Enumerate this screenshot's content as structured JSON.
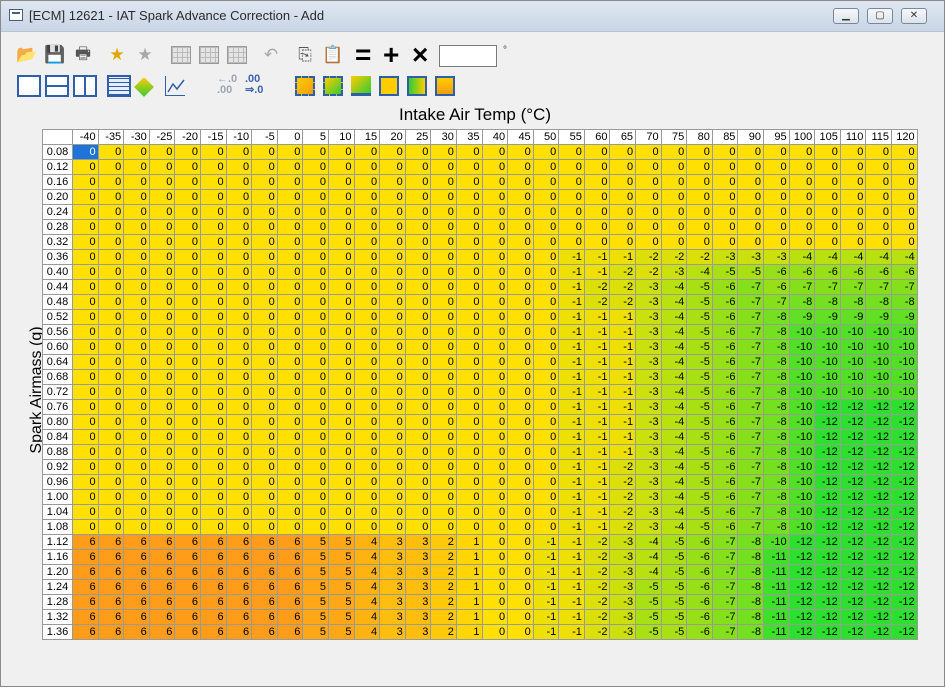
{
  "window": {
    "title": "[ECM] 12621 - IAT Spark Advance Correction - Add",
    "controls": [
      "minimize",
      "maximize",
      "close"
    ]
  },
  "toolbar": {
    "input_value": "",
    "unit": "°",
    "ops": [
      "=",
      "+",
      "×"
    ],
    "small_labels": {
      "decimal_fewer": "←.0",
      "decimal_fewer2": ".00",
      "decimal_more": ".00",
      "decimal_more2": "⇒.0"
    }
  },
  "table": {
    "x_axis_title": "Intake Air Temp (°C)",
    "y_axis_title": "Spark Airmass (g)",
    "columns": [
      "-40",
      "-35",
      "-30",
      "-25",
      "-20",
      "-15",
      "-10",
      "-5",
      "0",
      "5",
      "10",
      "15",
      "20",
      "25",
      "30",
      "35",
      "40",
      "45",
      "50",
      "55",
      "60",
      "65",
      "70",
      "75",
      "80",
      "85",
      "90",
      "95",
      "100",
      "105",
      "110",
      "115",
      "120"
    ],
    "rows": [
      {
        "label": "0.08",
        "values": [
          0,
          0,
          0,
          0,
          0,
          0,
          0,
          0,
          0,
          0,
          0,
          0,
          0,
          0,
          0,
          0,
          0,
          0,
          0,
          0,
          0,
          0,
          0,
          0,
          0,
          0,
          0,
          0,
          0,
          0,
          0,
          0,
          0
        ]
      },
      {
        "label": "0.12",
        "values": [
          0,
          0,
          0,
          0,
          0,
          0,
          0,
          0,
          0,
          0,
          0,
          0,
          0,
          0,
          0,
          0,
          0,
          0,
          0,
          0,
          0,
          0,
          0,
          0,
          0,
          0,
          0,
          0,
          0,
          0,
          0,
          0,
          0
        ]
      },
      {
        "label": "0.16",
        "values": [
          0,
          0,
          0,
          0,
          0,
          0,
          0,
          0,
          0,
          0,
          0,
          0,
          0,
          0,
          0,
          0,
          0,
          0,
          0,
          0,
          0,
          0,
          0,
          0,
          0,
          0,
          0,
          0,
          0,
          0,
          0,
          0,
          0
        ]
      },
      {
        "label": "0.20",
        "values": [
          0,
          0,
          0,
          0,
          0,
          0,
          0,
          0,
          0,
          0,
          0,
          0,
          0,
          0,
          0,
          0,
          0,
          0,
          0,
          0,
          0,
          0,
          0,
          0,
          0,
          0,
          0,
          0,
          0,
          0,
          0,
          0,
          0
        ]
      },
      {
        "label": "0.24",
        "values": [
          0,
          0,
          0,
          0,
          0,
          0,
          0,
          0,
          0,
          0,
          0,
          0,
          0,
          0,
          0,
          0,
          0,
          0,
          0,
          0,
          0,
          0,
          0,
          0,
          0,
          0,
          0,
          0,
          0,
          0,
          0,
          0,
          0
        ]
      },
      {
        "label": "0.28",
        "values": [
          0,
          0,
          0,
          0,
          0,
          0,
          0,
          0,
          0,
          0,
          0,
          0,
          0,
          0,
          0,
          0,
          0,
          0,
          0,
          0,
          0,
          0,
          0,
          0,
          0,
          0,
          0,
          0,
          0,
          0,
          0,
          0,
          0
        ]
      },
      {
        "label": "0.32",
        "values": [
          0,
          0,
          0,
          0,
          0,
          0,
          0,
          0,
          0,
          0,
          0,
          0,
          0,
          0,
          0,
          0,
          0,
          0,
          0,
          0,
          0,
          0,
          0,
          0,
          0,
          0,
          0,
          0,
          0,
          0,
          0,
          0,
          0
        ]
      },
      {
        "label": "0.36",
        "values": [
          0,
          0,
          0,
          0,
          0,
          0,
          0,
          0,
          0,
          0,
          0,
          0,
          0,
          0,
          0,
          0,
          0,
          0,
          0,
          -1,
          -1,
          -1,
          -2,
          -2,
          -2,
          -3,
          -3,
          -3,
          -4,
          -4,
          -4,
          -4,
          -4
        ]
      },
      {
        "label": "0.40",
        "values": [
          0,
          0,
          0,
          0,
          0,
          0,
          0,
          0,
          0,
          0,
          0,
          0,
          0,
          0,
          0,
          0,
          0,
          0,
          0,
          -1,
          -1,
          -2,
          -2,
          -3,
          -4,
          -5,
          -5,
          -6,
          -6,
          -6,
          -6,
          -6,
          -6
        ]
      },
      {
        "label": "0.44",
        "values": [
          0,
          0,
          0,
          0,
          0,
          0,
          0,
          0,
          0,
          0,
          0,
          0,
          0,
          0,
          0,
          0,
          0,
          0,
          0,
          -1,
          -2,
          -2,
          -3,
          -4,
          -5,
          -6,
          -7,
          -6,
          -7,
          -7,
          -7,
          -7,
          -7
        ]
      },
      {
        "label": "0.48",
        "values": [
          0,
          0,
          0,
          0,
          0,
          0,
          0,
          0,
          0,
          0,
          0,
          0,
          0,
          0,
          0,
          0,
          0,
          0,
          0,
          -1,
          -2,
          -2,
          -3,
          -4,
          -5,
          -6,
          -7,
          -7,
          -8,
          -8,
          -8,
          -8,
          -8
        ]
      },
      {
        "label": "0.52",
        "values": [
          0,
          0,
          0,
          0,
          0,
          0,
          0,
          0,
          0,
          0,
          0,
          0,
          0,
          0,
          0,
          0,
          0,
          0,
          0,
          -1,
          -1,
          -1,
          -3,
          -4,
          -5,
          -6,
          -7,
          -8,
          -9,
          -9,
          -9,
          -9,
          -9
        ]
      },
      {
        "label": "0.56",
        "values": [
          0,
          0,
          0,
          0,
          0,
          0,
          0,
          0,
          0,
          0,
          0,
          0,
          0,
          0,
          0,
          0,
          0,
          0,
          0,
          -1,
          -1,
          -1,
          -3,
          -4,
          -5,
          -6,
          -7,
          -8,
          -10,
          -10,
          -10,
          -10,
          -10
        ]
      },
      {
        "label": "0.60",
        "values": [
          0,
          0,
          0,
          0,
          0,
          0,
          0,
          0,
          0,
          0,
          0,
          0,
          0,
          0,
          0,
          0,
          0,
          0,
          0,
          -1,
          -1,
          -1,
          -3,
          -4,
          -5,
          -6,
          -7,
          -8,
          -10,
          -10,
          -10,
          -10,
          -10
        ]
      },
      {
        "label": "0.64",
        "values": [
          0,
          0,
          0,
          0,
          0,
          0,
          0,
          0,
          0,
          0,
          0,
          0,
          0,
          0,
          0,
          0,
          0,
          0,
          0,
          -1,
          -1,
          -1,
          -3,
          -4,
          -5,
          -6,
          -7,
          -8,
          -10,
          -10,
          -10,
          -10,
          -10
        ]
      },
      {
        "label": "0.68",
        "values": [
          0,
          0,
          0,
          0,
          0,
          0,
          0,
          0,
          0,
          0,
          0,
          0,
          0,
          0,
          0,
          0,
          0,
          0,
          0,
          -1,
          -1,
          -1,
          -3,
          -4,
          -5,
          -6,
          -7,
          -8,
          -10,
          -10,
          -10,
          -10,
          -10
        ]
      },
      {
        "label": "0.72",
        "values": [
          0,
          0,
          0,
          0,
          0,
          0,
          0,
          0,
          0,
          0,
          0,
          0,
          0,
          0,
          0,
          0,
          0,
          0,
          0,
          -1,
          -1,
          -1,
          -3,
          -4,
          -5,
          -6,
          -7,
          -8,
          -10,
          -10,
          -10,
          -10,
          -10
        ]
      },
      {
        "label": "0.76",
        "values": [
          0,
          0,
          0,
          0,
          0,
          0,
          0,
          0,
          0,
          0,
          0,
          0,
          0,
          0,
          0,
          0,
          0,
          0,
          0,
          -1,
          -1,
          -1,
          -3,
          -4,
          -5,
          -6,
          -7,
          -8,
          -10,
          -12,
          -12,
          -12,
          -12
        ]
      },
      {
        "label": "0.80",
        "values": [
          0,
          0,
          0,
          0,
          0,
          0,
          0,
          0,
          0,
          0,
          0,
          0,
          0,
          0,
          0,
          0,
          0,
          0,
          0,
          -1,
          -1,
          -1,
          -3,
          -4,
          -5,
          -6,
          -7,
          -8,
          -10,
          -12,
          -12,
          -12,
          -12
        ]
      },
      {
        "label": "0.84",
        "values": [
          0,
          0,
          0,
          0,
          0,
          0,
          0,
          0,
          0,
          0,
          0,
          0,
          0,
          0,
          0,
          0,
          0,
          0,
          0,
          -1,
          -1,
          -1,
          -3,
          -4,
          -5,
          -6,
          -7,
          -8,
          -10,
          -12,
          -12,
          -12,
          -12
        ]
      },
      {
        "label": "0.88",
        "values": [
          0,
          0,
          0,
          0,
          0,
          0,
          0,
          0,
          0,
          0,
          0,
          0,
          0,
          0,
          0,
          0,
          0,
          0,
          0,
          -1,
          -1,
          -1,
          -3,
          -4,
          -5,
          -6,
          -7,
          -8,
          -10,
          -12,
          -12,
          -12,
          -12
        ]
      },
      {
        "label": "0.92",
        "values": [
          0,
          0,
          0,
          0,
          0,
          0,
          0,
          0,
          0,
          0,
          0,
          0,
          0,
          0,
          0,
          0,
          0,
          0,
          0,
          -1,
          -1,
          -2,
          -3,
          -4,
          -5,
          -6,
          -7,
          -8,
          -10,
          -12,
          -12,
          -12,
          -12
        ]
      },
      {
        "label": "0.96",
        "values": [
          0,
          0,
          0,
          0,
          0,
          0,
          0,
          0,
          0,
          0,
          0,
          0,
          0,
          0,
          0,
          0,
          0,
          0,
          0,
          -1,
          -1,
          -2,
          -3,
          -4,
          -5,
          -6,
          -7,
          -8,
          -10,
          -12,
          -12,
          -12,
          -12
        ]
      },
      {
        "label": "1.00",
        "values": [
          0,
          0,
          0,
          0,
          0,
          0,
          0,
          0,
          0,
          0,
          0,
          0,
          0,
          0,
          0,
          0,
          0,
          0,
          0,
          -1,
          -1,
          -2,
          -3,
          -4,
          -5,
          -6,
          -7,
          -8,
          -10,
          -12,
          -12,
          -12,
          -12
        ]
      },
      {
        "label": "1.04",
        "values": [
          0,
          0,
          0,
          0,
          0,
          0,
          0,
          0,
          0,
          0,
          0,
          0,
          0,
          0,
          0,
          0,
          0,
          0,
          0,
          -1,
          -1,
          -2,
          -3,
          -4,
          -5,
          -6,
          -7,
          -8,
          -10,
          -12,
          -12,
          -12,
          -12
        ]
      },
      {
        "label": "1.08",
        "values": [
          0,
          0,
          0,
          0,
          0,
          0,
          0,
          0,
          0,
          0,
          0,
          0,
          0,
          0,
          0,
          0,
          0,
          0,
          0,
          -1,
          -1,
          -2,
          -3,
          -4,
          -5,
          -6,
          -7,
          -8,
          -10,
          -12,
          -12,
          -12,
          -12
        ]
      },
      {
        "label": "1.12",
        "values": [
          6,
          6,
          6,
          6,
          6,
          6,
          6,
          6,
          6,
          5,
          5,
          4,
          3,
          3,
          2,
          1,
          0,
          0,
          -1,
          -1,
          -2,
          -3,
          -4,
          -5,
          -6,
          -7,
          -8,
          -10,
          -12,
          -12,
          -12,
          -12,
          -12
        ]
      },
      {
        "label": "1.16",
        "values": [
          6,
          6,
          6,
          6,
          6,
          6,
          6,
          6,
          6,
          5,
          5,
          4,
          3,
          3,
          2,
          1,
          0,
          0,
          -1,
          -1,
          -2,
          -3,
          -4,
          -5,
          -6,
          -7,
          -8,
          -11,
          -12,
          -12,
          -12,
          -12,
          -12
        ]
      },
      {
        "label": "1.20",
        "values": [
          6,
          6,
          6,
          6,
          6,
          6,
          6,
          6,
          6,
          5,
          5,
          4,
          3,
          3,
          2,
          1,
          0,
          0,
          -1,
          -1,
          -2,
          -3,
          -4,
          -5,
          -6,
          -7,
          -8,
          -11,
          -12,
          -12,
          -12,
          -12,
          -12
        ]
      },
      {
        "label": "1.24",
        "values": [
          6,
          6,
          6,
          6,
          6,
          6,
          6,
          6,
          6,
          5,
          5,
          4,
          3,
          3,
          2,
          1,
          0,
          0,
          -1,
          -1,
          -2,
          -3,
          -5,
          -5,
          -6,
          -7,
          -8,
          -11,
          -12,
          -12,
          -12,
          -12,
          -12
        ]
      },
      {
        "label": "1.28",
        "values": [
          6,
          6,
          6,
          6,
          6,
          6,
          6,
          6,
          6,
          5,
          5,
          4,
          3,
          3,
          2,
          1,
          0,
          0,
          -1,
          -1,
          -2,
          -3,
          -5,
          -5,
          -6,
          -7,
          -8,
          -11,
          -12,
          -12,
          -12,
          -12,
          -12
        ]
      },
      {
        "label": "1.32",
        "values": [
          6,
          6,
          6,
          6,
          6,
          6,
          6,
          6,
          6,
          5,
          5,
          4,
          3,
          3,
          2,
          1,
          0,
          0,
          -1,
          -1,
          -2,
          -3,
          -5,
          -5,
          -6,
          -7,
          -8,
          -11,
          -12,
          -12,
          -12,
          -12,
          -12
        ]
      },
      {
        "label": "1.36",
        "values": [
          6,
          6,
          6,
          6,
          6,
          6,
          6,
          6,
          6,
          5,
          5,
          4,
          3,
          3,
          2,
          1,
          0,
          0,
          -1,
          -1,
          -2,
          -3,
          -5,
          -5,
          -6,
          -7,
          -8,
          -11,
          -12,
          -12,
          -12,
          -12,
          -12
        ]
      }
    ],
    "selected_cell": {
      "row": 0,
      "col": 0
    },
    "colors": {
      "positive": "#ff9c1a",
      "zero": "#ffe000",
      "negative_max": "#2ee02e",
      "selected": "#1e73d7"
    }
  }
}
